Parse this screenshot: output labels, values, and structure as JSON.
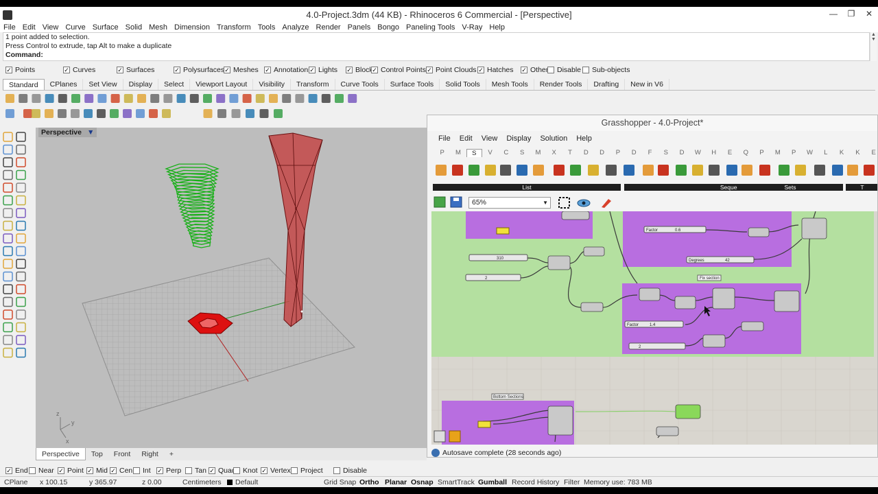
{
  "window": {
    "title": "4.0-Project.3dm (44 KB) - Rhinoceros 6 Commercial - [Perspective]",
    "controls": [
      "—",
      "❐",
      "✕"
    ]
  },
  "menu": [
    "File",
    "Edit",
    "View",
    "Curve",
    "Surface",
    "Solid",
    "Mesh",
    "Dimension",
    "Transform",
    "Tools",
    "Analyze",
    "Render",
    "Panels",
    "Bongo",
    "Paneling Tools",
    "V-Ray",
    "Help"
  ],
  "command_history": [
    "1 point added to selection.",
    "Press Control to extrude, tap Alt to make a duplicate"
  ],
  "command_prompt": "Command:",
  "filters": [
    {
      "label": "Points",
      "checked": true
    },
    {
      "label": "Curves",
      "checked": true
    },
    {
      "label": "Surfaces",
      "checked": true
    },
    {
      "label": "Polysurfaces",
      "checked": true
    },
    {
      "label": "Meshes",
      "checked": true
    },
    {
      "label": "Annotations",
      "checked": true
    },
    {
      "label": "Lights",
      "checked": true
    },
    {
      "label": "Blocks",
      "checked": true
    },
    {
      "label": "Control Points",
      "checked": true
    },
    {
      "label": "Point Clouds",
      "checked": true
    },
    {
      "label": "Hatches",
      "checked": true
    },
    {
      "label": "Others",
      "checked": true
    },
    {
      "label": "Disable",
      "checked": false
    },
    {
      "label": "Sub-objects",
      "checked": false
    }
  ],
  "toolbar_tabs": [
    "Standard",
    "CPlanes",
    "Set View",
    "Display",
    "Select",
    "Viewport Layout",
    "Visibility",
    "Transform",
    "Curve Tools",
    "Surface Tools",
    "Solid Tools",
    "Mesh Tools",
    "Render Tools",
    "Drafting",
    "New in V6"
  ],
  "viewport": {
    "name": "Perspective",
    "caret": "▼",
    "axis": {
      "x": "x",
      "y": "y",
      "z": "z"
    }
  },
  "view_tabs": [
    "Perspective",
    "Top",
    "Front",
    "Right",
    "+"
  ],
  "grasshopper": {
    "title": "Grasshopper - 4.0-Project*",
    "menu": [
      "File",
      "Edit",
      "View",
      "Display",
      "Solution",
      "Help"
    ],
    "categories": [
      "P",
      "M",
      "S",
      "V",
      "C",
      "S",
      "M",
      "X",
      "T",
      "D",
      "D",
      "P",
      "D",
      "F",
      "S",
      "D",
      "W",
      "H",
      "E",
      "Q",
      "P",
      "M",
      "P",
      "W",
      "L",
      "K",
      "K",
      "E"
    ],
    "active_category_index": 2,
    "panels": [
      "List",
      "Sequence",
      "Sets",
      "T"
    ],
    "zoom": "65%",
    "status": "Autosave complete (28 seconds ago)",
    "canvas_labels": {
      "factor1": "Factor",
      "factor1_val": "0.6",
      "degrees": "Degrees",
      "degrees_val": "42",
      "slider_a": "310",
      "slider_b": "2",
      "fix_section": "Fix section",
      "factor2": "Factor",
      "factor2_val": "1.4",
      "slider_c": "2",
      "bottom_sections": "Bottom Sections"
    }
  },
  "osnaps": [
    {
      "label": "End",
      "checked": true
    },
    {
      "label": "Near",
      "checked": false
    },
    {
      "label": "Point",
      "checked": true
    },
    {
      "label": "Mid",
      "checked": true
    },
    {
      "label": "Cen",
      "checked": true
    },
    {
      "label": "Int",
      "checked": false
    },
    {
      "label": "Perp",
      "checked": true
    },
    {
      "label": "Tan",
      "checked": false
    },
    {
      "label": "Quad",
      "checked": true
    },
    {
      "label": "Knot",
      "checked": false
    },
    {
      "label": "Vertex",
      "checked": true
    },
    {
      "label": "Project",
      "checked": false
    },
    {
      "label": "Disable",
      "checked": false
    }
  ],
  "status": {
    "cplane": "CPlane",
    "x": "x 100.15",
    "y": "y 365.97",
    "z": "z 0.00",
    "units": "Centimeters",
    "layer": "Default",
    "grid_snap": "Grid Snap",
    "ortho": "Ortho",
    "planar": "Planar",
    "osnap": "Osnap",
    "smarttrack": "SmartTrack",
    "gumball": "Gumball",
    "record_history": "Record History",
    "filter": "Filter",
    "memory": "Memory use: 783 MB"
  },
  "colors": {
    "viewport_bg": "#bdbdbd",
    "green_object": "#1fb01f",
    "red_object": "#c42222",
    "gh_purple": "#b86ee0",
    "gh_green": "#b5e2a2"
  }
}
